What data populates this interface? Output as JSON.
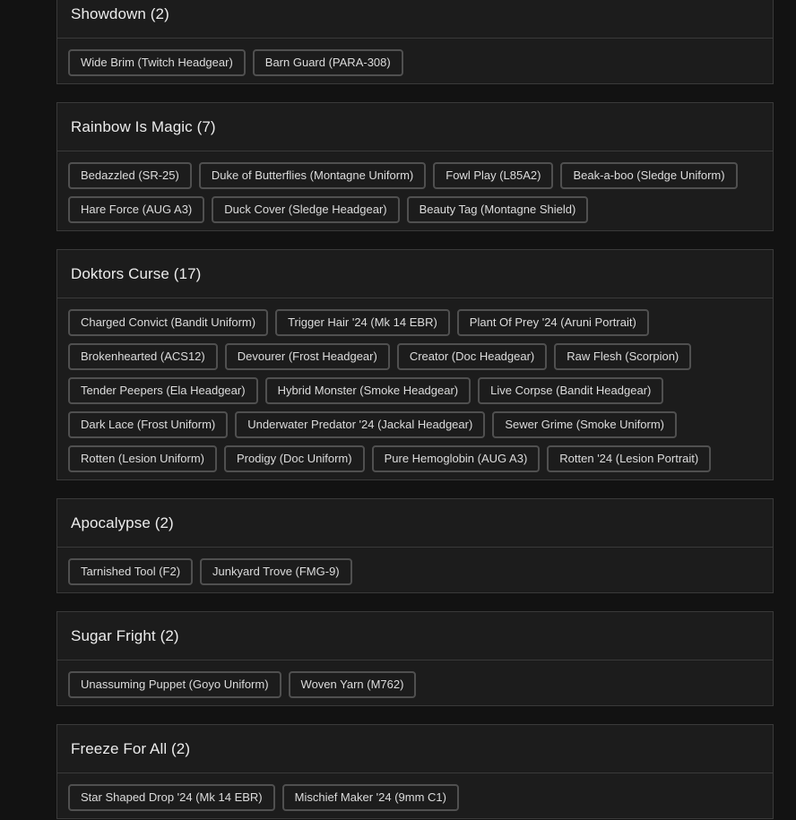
{
  "sections": [
    {
      "title": "Showdown (2)",
      "items": [
        "Wide Brim (Twitch Headgear)",
        "Barn Guard (PARA-308)"
      ]
    },
    {
      "title": "Rainbow Is Magic (7)",
      "items": [
        "Bedazzled (SR-25)",
        "Duke of Butterflies (Montagne Uniform)",
        "Fowl Play (L85A2)",
        "Beak-a-boo (Sledge Uniform)",
        "Hare Force (AUG A3)",
        "Duck Cover (Sledge Headgear)",
        "Beauty Tag (Montagne Shield)"
      ]
    },
    {
      "title": "Doktors Curse (17)",
      "items": [
        "Charged Convict (Bandit Uniform)",
        "Trigger Hair '24 (Mk 14 EBR)",
        "Plant Of Prey '24 (Aruni Portrait)",
        "Brokenhearted (ACS12)",
        "Devourer (Frost Headgear)",
        "Creator (Doc Headgear)",
        "Raw Flesh (Scorpion)",
        "Tender Peepers (Ela Headgear)",
        "Hybrid Monster (Smoke Headgear)",
        "Live Corpse (Bandit Headgear)",
        "Dark Lace (Frost Uniform)",
        "Underwater Predator '24 (Jackal Headgear)",
        "Sewer Grime (Smoke Uniform)",
        "Rotten (Lesion Uniform)",
        "Prodigy (Doc Uniform)",
        "Pure Hemoglobin (AUG A3)",
        "Rotten '24 (Lesion Portrait)"
      ]
    },
    {
      "title": "Apocalypse (2)",
      "items": [
        "Tarnished Tool (F2)",
        "Junkyard Trove (FMG-9)"
      ]
    },
    {
      "title": "Sugar Fright (2)",
      "items": [
        "Unassuming Puppet (Goyo Uniform)",
        "Woven Yarn (M762)"
      ]
    },
    {
      "title": "Freeze For All (2)",
      "items": [
        "Star Shaped Drop '24 (Mk 14 EBR)",
        "Mischief Maker '24 (9mm C1)"
      ]
    }
  ]
}
